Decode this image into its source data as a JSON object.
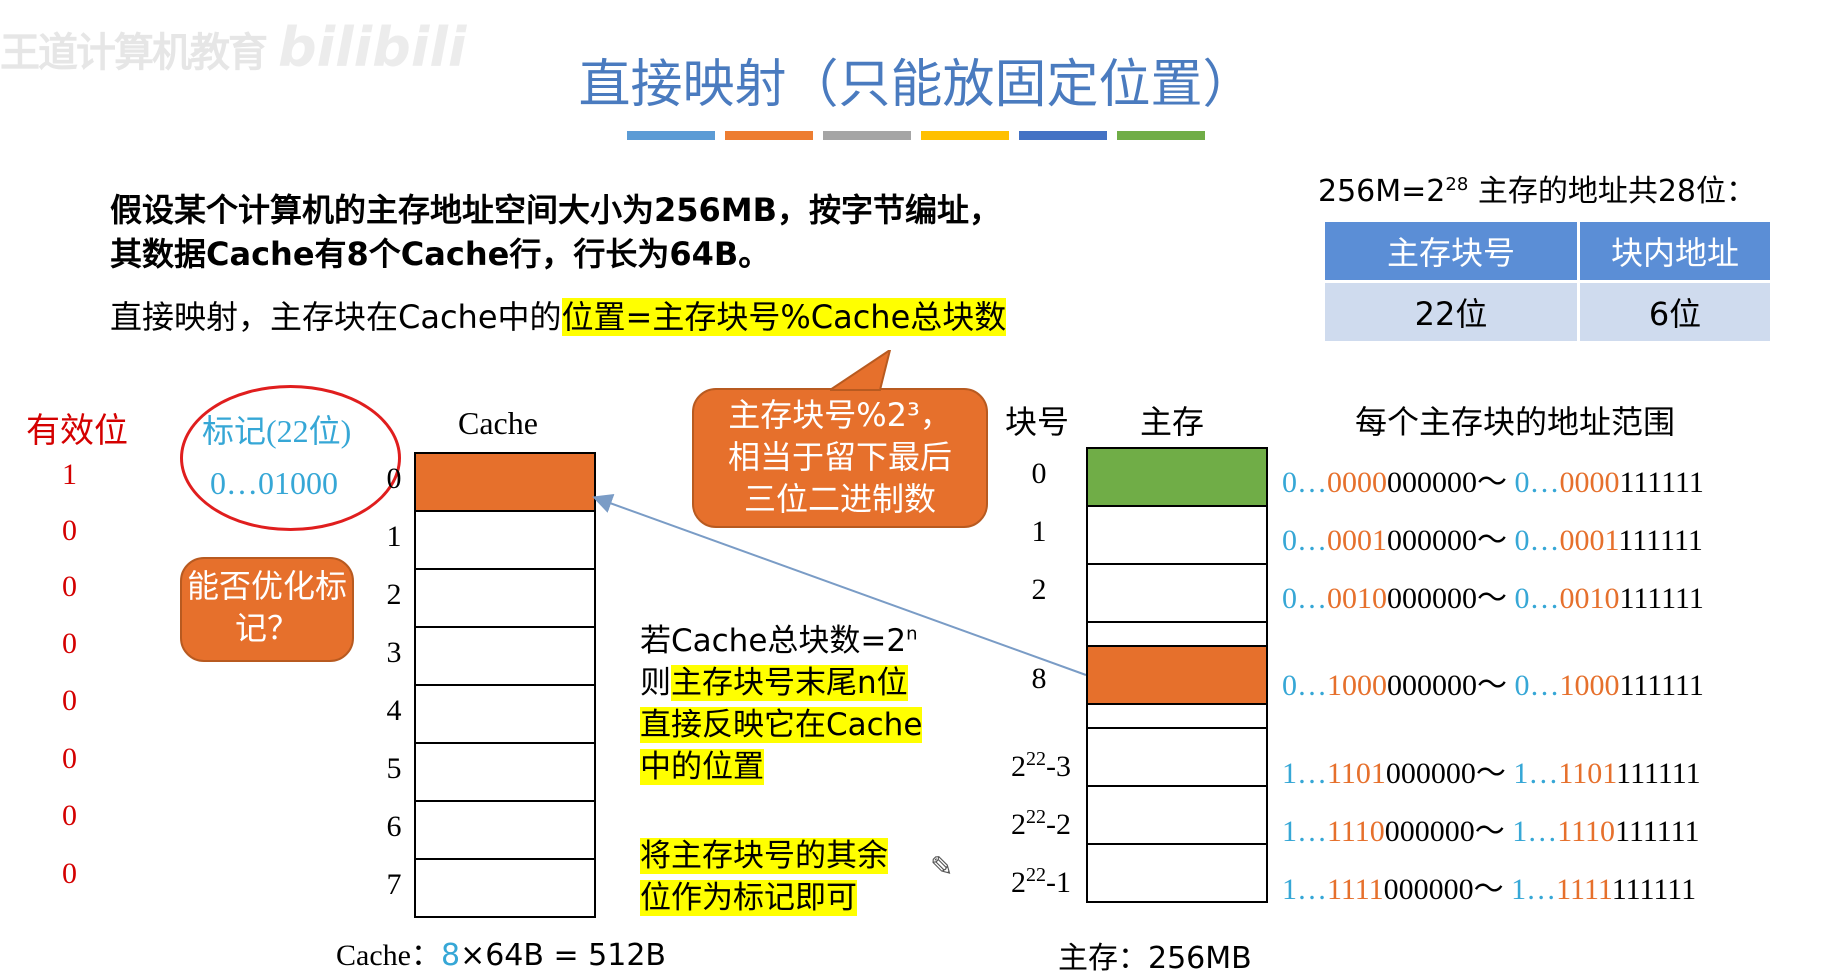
{
  "watermark": {
    "text": "王道计算机教育",
    "brand": "bilibili"
  },
  "title": "直接映射（只能放固定位置）",
  "bar_colors": [
    "#5b9bd5",
    "#ed7d31",
    "#a5a5a5",
    "#ffc000",
    "#4472c4",
    "#70ad47"
  ],
  "intro": "假设某个计算机的主存地址空间大小为256MB，按字节编址，其数据Cache有8个Cache行，行长为64B。",
  "rule": {
    "prefix": "直接映射，主存块在Cache中的",
    "highlight": "位置=主存块号%Cache总块数"
  },
  "address": {
    "note_base": "256M=2",
    "note_exp": "28",
    "note_rest": " 主存的地址共28位：",
    "headers": [
      "主存块号",
      "块内地址"
    ],
    "values": [
      "22位",
      "6位"
    ]
  },
  "labels": {
    "valid": "有效位",
    "tag": "标记(22位)",
    "tag_value": "0…01000",
    "cache": "Cache"
  },
  "valid_bits": [
    "1",
    "0",
    "0",
    "0",
    "0",
    "0",
    "0",
    "0"
  ],
  "cache_indices": [
    "0",
    "1",
    "2",
    "3",
    "4",
    "5",
    "6",
    "7"
  ],
  "bubble_optimize": "能否优化标记？",
  "bubble_mod": {
    "line1": "主存块号%2³，",
    "line2": "相当于留下最后",
    "line3": "三位二进制数"
  },
  "cache_note": {
    "prefix": "Cache：",
    "count": "8",
    "rest": "×64B = 512B"
  },
  "side_text": {
    "line1a": "若Cache总块数=2",
    "line1sup": "n",
    "line2a": "则",
    "line2h": "主存块号末尾n位",
    "line3": "直接反映它在Cache",
    "line4": "中的位置",
    "line5": "将主存块号的其余",
    "line6": "位作为标记即可"
  },
  "memory": {
    "header_block": "块号",
    "header_mem": "主存",
    "header_range": "每个主存块的地址范围",
    "note": "主存：256MB",
    "colors": {
      "block0": "#70ad47",
      "block8": "#e6702c"
    },
    "rows": [
      {
        "idx": "0",
        "a1": "0…",
        "a2": "0000",
        "a3": "000000",
        "sep": "～ ",
        "b1": "0…",
        "b2": "0000",
        "b3": "111111"
      },
      {
        "idx": "1",
        "a1": "0…",
        "a2": "0001",
        "a3": "000000",
        "sep": "～ ",
        "b1": "0…",
        "b2": "0001",
        "b3": "111111"
      },
      {
        "idx": "2",
        "a1": "0…",
        "a2": "0010",
        "a3": "000000",
        "sep": "～ ",
        "b1": "0…",
        "b2": "0010",
        "b3": "111111"
      },
      {
        "idx": "8",
        "a1": "0…",
        "a2": "1000",
        "a3": "000000",
        "sep": "～ ",
        "b1": "0…",
        "b2": "1000",
        "b3": "111111"
      },
      {
        "idx_base": "2",
        "idx_exp": "22",
        "idx_tail": "-3",
        "a1": "1…",
        "a2": "1101",
        "a3": "000000",
        "sep": "～ ",
        "b1": "1…",
        "b2": "1101",
        "b3": "111111"
      },
      {
        "idx_base": "2",
        "idx_exp": "22",
        "idx_tail": "-2",
        "a1": "1…",
        "a2": "1110",
        "a3": "000000",
        "sep": "～ ",
        "b1": "1…",
        "b2": "1110",
        "b3": "111111"
      },
      {
        "idx_base": "2",
        "idx_exp": "22",
        "idx_tail": "-1",
        "a1": "1…",
        "a2": "1111",
        "a3": "000000",
        "sep": "～ ",
        "b1": "1…",
        "b2": "1111",
        "b3": "111111"
      }
    ]
  }
}
